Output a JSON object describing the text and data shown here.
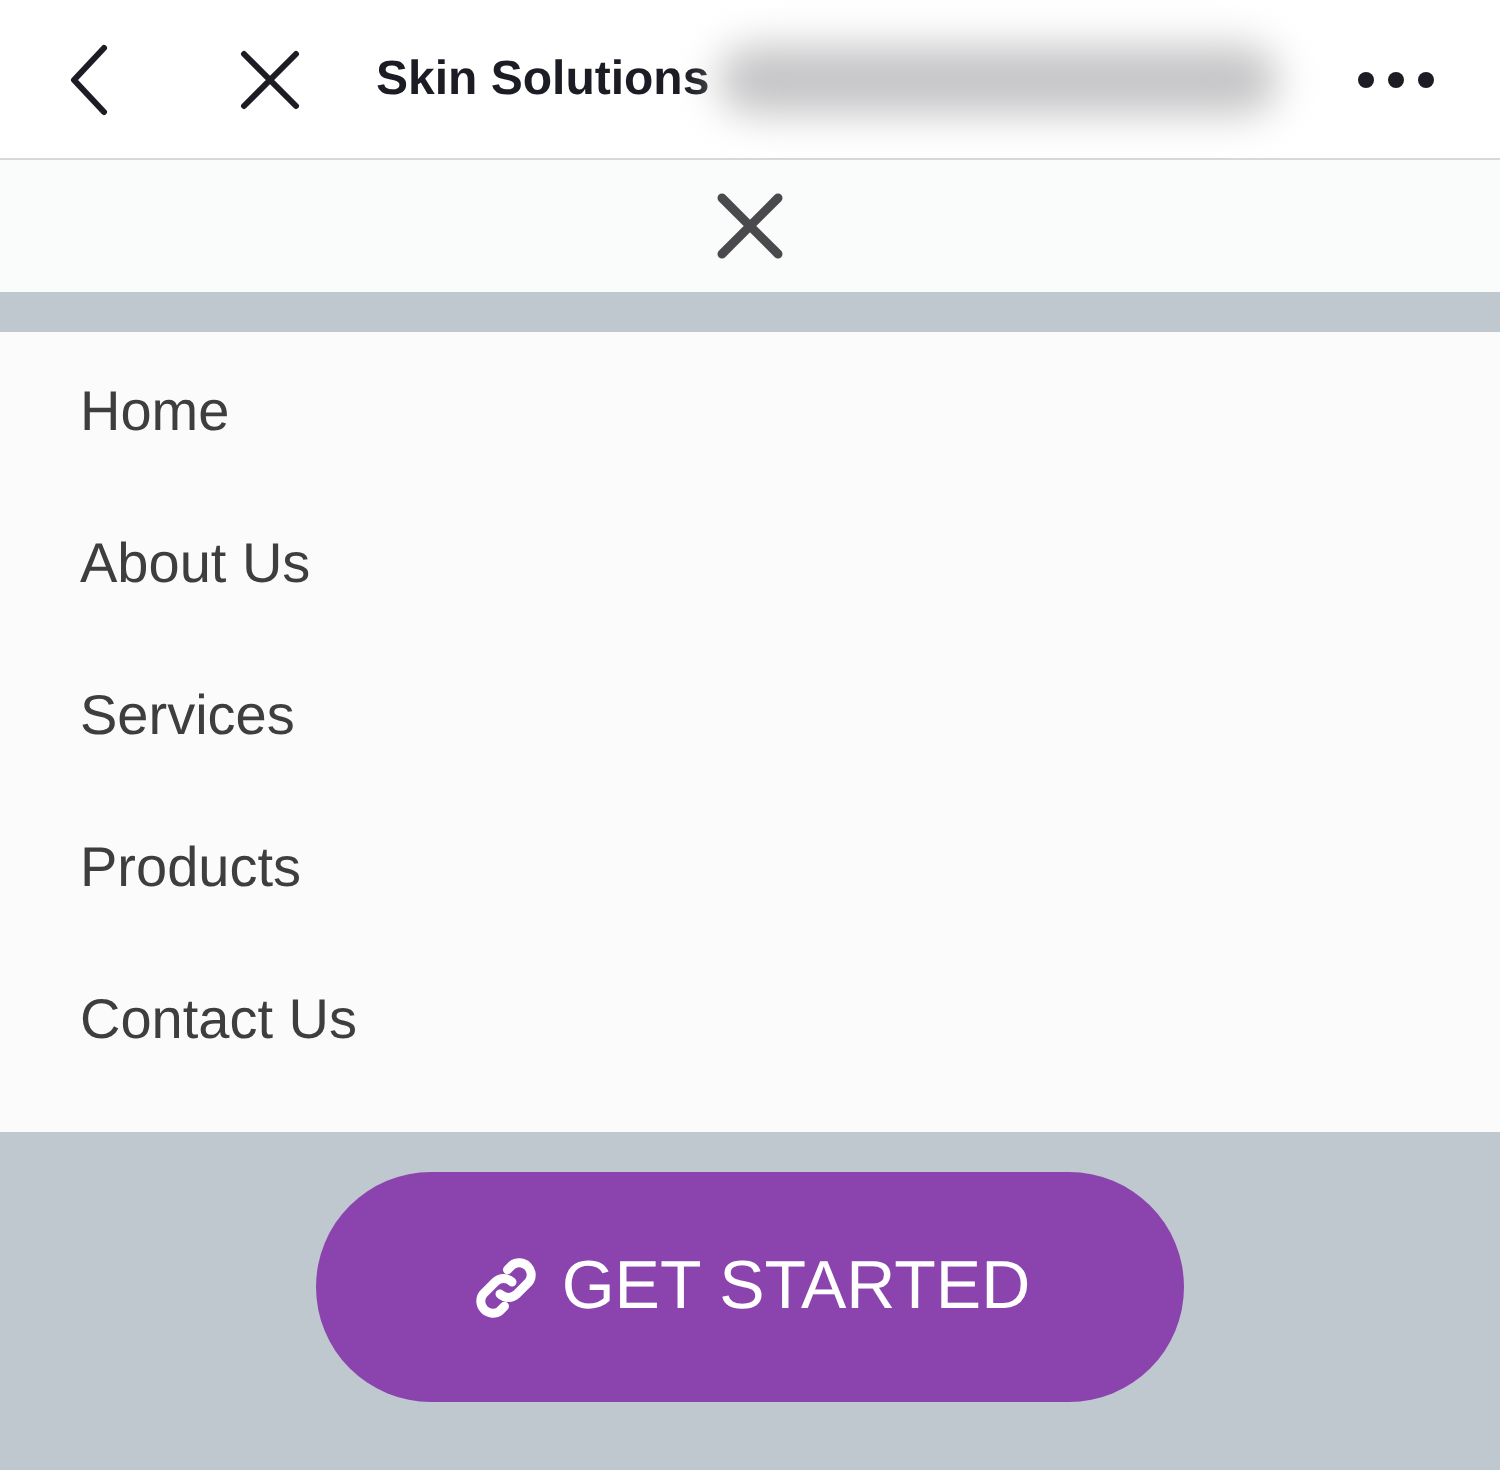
{
  "top_bar": {
    "title": "Skin Solutions"
  },
  "menu": {
    "items": [
      {
        "label": "Home"
      },
      {
        "label": "About Us"
      },
      {
        "label": "Services"
      },
      {
        "label": "Products"
      },
      {
        "label": "Contact Us"
      }
    ]
  },
  "cta": {
    "label": "GET STARTED"
  }
}
